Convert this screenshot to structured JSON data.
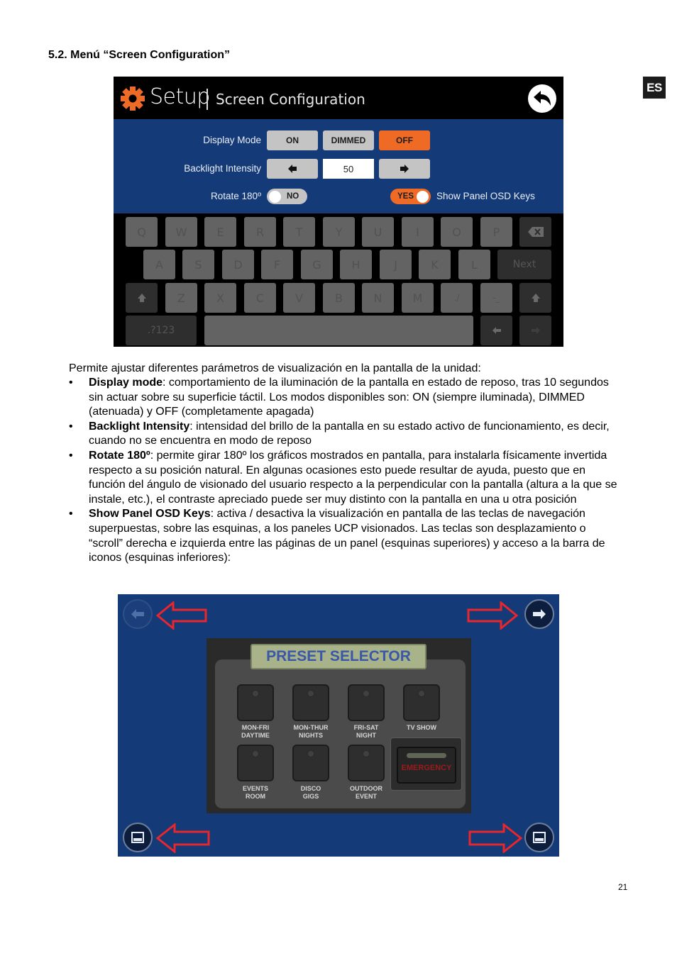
{
  "section_title": "5.2. Menú “Screen Configuration”",
  "lang_badge": "ES",
  "setup_screen": {
    "title": "Setup",
    "subtitle": "Screen Configuration",
    "icons": {
      "settings": "gear-icon",
      "back": "back-arrow-icon"
    },
    "colors": {
      "accent": "#ef6b25",
      "body_bg": "#153a78",
      "header_bg": "#000000"
    },
    "display_mode": {
      "label": "Display Mode",
      "options": [
        "ON",
        "DIMMED",
        "OFF"
      ],
      "selected": "OFF"
    },
    "backlight": {
      "label": "Backlight Intensity",
      "value": "50",
      "decrease_icon": "arrow-left-icon",
      "increase_icon": "arrow-right-icon"
    },
    "rotate": {
      "label": "Rotate 180º",
      "state": "NO"
    },
    "osd_keys": {
      "label": "Show Panel OSD Keys",
      "state": "YES"
    },
    "keyboard": {
      "row1": [
        "Q",
        "W",
        "E",
        "R",
        "T",
        "Y",
        "U",
        "I",
        "O",
        "P"
      ],
      "row2": [
        "A",
        "S",
        "D",
        "F",
        "G",
        "H",
        "J",
        "K",
        "L"
      ],
      "row3": [
        "Z",
        "X",
        "C",
        "V",
        "B",
        "N",
        "M",
        "./",
        "-_"
      ],
      "next_label": "Next",
      "symbols_label": ".?123"
    }
  },
  "intro": "Permite ajustar diferentes parámetros de visualización en la pantalla de la unidad:",
  "bullets": [
    {
      "term": "Display mode",
      "text": ": comportamiento de la iluminación de la pantalla en estado de reposo, tras 10 segundos sin actuar sobre su superficie táctil. Los modos disponibles son: ON (siempre iluminada), DIMMED (atenuada) y OFF (completamente apagada)"
    },
    {
      "term": "Backlight Intensity",
      "text": ": intensidad del brillo de la pantalla en su estado activo de funcionamiento, es decir, cuando no se encuentra en modo de reposo"
    },
    {
      "term": "Rotate 180º",
      "text": ": permite girar 180º los gráficos mostrados en pantalla, para instalarla físicamente invertida respecto a su posición natural. En algunas ocasiones esto puede resultar de ayuda, puesto que en función del ángulo de visionado del usuario respecto a la perpendicular con la pantalla (altura a la que se instale, etc.), el contraste apreciado puede ser muy distinto con la pantalla en una u otra posición"
    },
    {
      "term": "Show Panel OSD Keys",
      "text": ": activa / desactiva la visualización en pantalla de las teclas de navegación superpuestas, sobre las esquinas, a los paneles UCP visionados. Las teclas son desplazamiento o “scroll” derecha e izquierda entre las páginas de un panel (esquinas superiores) y acceso a la barra de iconos (esquinas inferiores):"
    }
  ],
  "panel_screen": {
    "title": "PRESET SELECTOR",
    "osd_icons": [
      "scroll-left-icon",
      "scroll-right-icon",
      "icon-bar-left-icon",
      "icon-bar-right-icon"
    ],
    "presets": [
      {
        "line1": "MON-FRI",
        "line2": "DAYTIME"
      },
      {
        "line1": "MON-THUR",
        "line2": "NIGHTS"
      },
      {
        "line1": "FRI-SAT",
        "line2": "NIGHT"
      },
      {
        "line1": "TV SHOW",
        "line2": ""
      },
      {
        "line1": "EVENTS",
        "line2": "ROOM"
      },
      {
        "line1": "DISCO",
        "line2": "GIGS"
      },
      {
        "line1": "OUTDOOR",
        "line2": "EVENT"
      }
    ],
    "emergency_label": "EMERGENCY",
    "annotation_color": "#e8262b"
  },
  "page_number": "21"
}
